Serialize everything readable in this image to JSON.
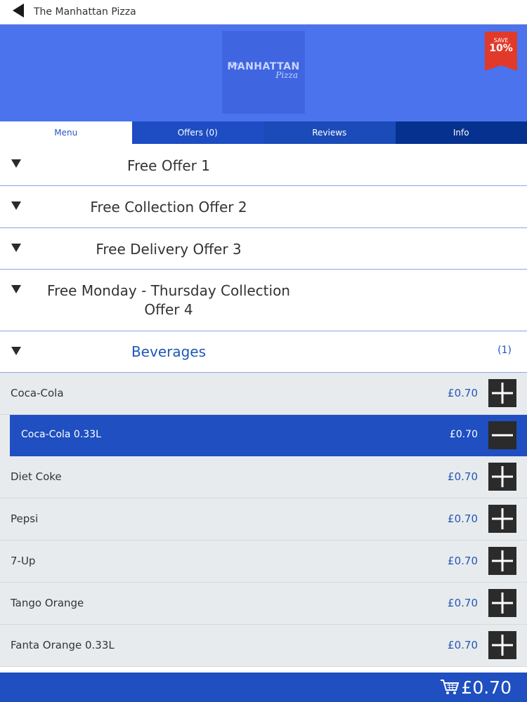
{
  "header": {
    "title": "The Manhattan Pizza",
    "back_icon": "back-arrow-icon"
  },
  "hero": {
    "logo": {
      "top": "The",
      "brand": "MANHATTAN",
      "sub": "Pizza"
    },
    "ribbon": {
      "top": "SAVE",
      "big": "10%"
    },
    "background": "#4a73ed"
  },
  "tabs": [
    {
      "label": "Menu",
      "active": true
    },
    {
      "label": "Offers (0)"
    },
    {
      "label": "Reviews"
    },
    {
      "label": "Info"
    }
  ],
  "categories": [
    {
      "line1": "Free Offer 1"
    },
    {
      "line1": "Free Collection Offer 2"
    },
    {
      "line1": "Free Delivery Offer 3"
    },
    {
      "line1": "Free Monday - Thursday Collection",
      "line2": "Offer 4"
    },
    {
      "line1": "Beverages",
      "count": "(1)",
      "expanded": true
    }
  ],
  "beverages": {
    "first": {
      "name": "Coca-Cola",
      "price": "£0.70"
    },
    "selected": {
      "name": "Coca-Cola 0.33L",
      "price": "£0.70"
    },
    "rest": [
      {
        "name": "Diet Coke",
        "price": "£0.70"
      },
      {
        "name": "Pepsi",
        "price": "£0.70"
      },
      {
        "name": "7-Up",
        "price": "£0.70"
      },
      {
        "name": "Tango Orange",
        "price": "£0.70"
      },
      {
        "name": "Fanta Orange 0.33L",
        "price": "£0.70"
      }
    ]
  },
  "cart": {
    "total": "£0.70",
    "icon": "cart-icon"
  },
  "colors": {
    "accent": "#1f4fc0",
    "text_accent": "#1f57b8",
    "ribbon": "#e23a2a"
  }
}
